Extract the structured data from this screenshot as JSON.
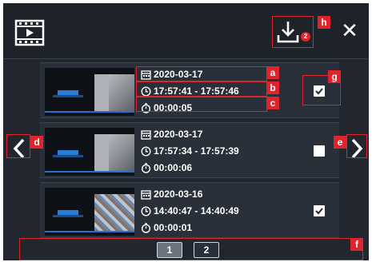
{
  "header": {
    "film_icon": "film-icon",
    "download_icon": "download-icon",
    "download_badge": "2",
    "close_icon": "close-icon",
    "close_glyph": "✕"
  },
  "recordings": [
    {
      "date": "2020-03-17",
      "time_range": "17:57:41 - 17:57:46",
      "duration": "00:00:05",
      "checked": true
    },
    {
      "date": "2020-03-17",
      "time_range": "17:57:34 - 17:57:39",
      "duration": "00:00:06",
      "checked": false
    },
    {
      "date": "2020-03-16",
      "time_range": "14:40:47 - 14:40:49",
      "duration": "00:00:01",
      "checked": true
    }
  ],
  "pagination": {
    "pages": [
      "1",
      "2"
    ],
    "current": "1"
  },
  "callouts": {
    "a": "a",
    "b": "b",
    "c": "c",
    "d": "d",
    "e": "e",
    "f": "f",
    "g": "g",
    "h": "h"
  },
  "colors": {
    "panel": "#22272f",
    "row": "#2a3039",
    "accent": "#e0242b",
    "active_page": "#6d7480"
  }
}
